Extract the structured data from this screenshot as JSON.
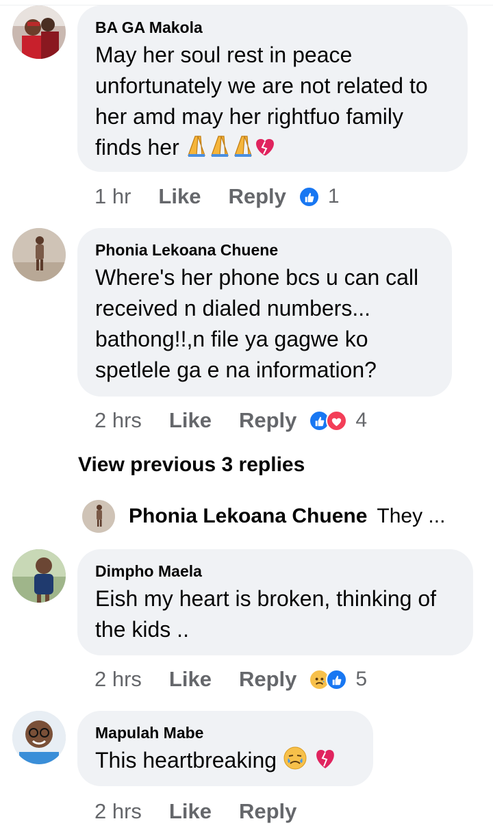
{
  "comments": [
    {
      "author": "BA GA Makola",
      "lines": [
        "May her soul rest in peace",
        "unfortunately we are not related to",
        "her amd may her rightfuo family",
        "finds her"
      ],
      "time": "1 hr",
      "like": "Like",
      "reply": "Reply",
      "reaction_count": "1"
    },
    {
      "author": "Phonia Lekoana Chuene",
      "lines": [
        "Where's her phone bcs u can call",
        "received n dialed numbers...",
        "bathong!!,n file ya gagwe ko",
        "spetlele ga e na information?"
      ],
      "time": "2 hrs",
      "like": "Like",
      "reply": "Reply",
      "reaction_count": "4"
    },
    {
      "author": "Dimpho Maela",
      "lines": [
        "Eish my heart is broken, thinking of",
        "the kids .."
      ],
      "time": "2 hrs",
      "like": "Like",
      "reply": "Reply",
      "reaction_count": "5"
    },
    {
      "author": "Mapulah Mabe",
      "lines": [
        "This heartbreaking"
      ],
      "time": "2 hrs",
      "like": "Like",
      "reply": "Reply"
    }
  ],
  "view_previous": "View previous 3 replies",
  "collapsed_reply": {
    "author": "Phonia Lekoana Chuene",
    "snippet": "They ..."
  },
  "colors": {
    "bubble": "#f0f2f5",
    "meta_text": "#65676b",
    "like_blue": "#1877f2",
    "love_red": "#f33e58",
    "heart_red": "#e0245e"
  }
}
